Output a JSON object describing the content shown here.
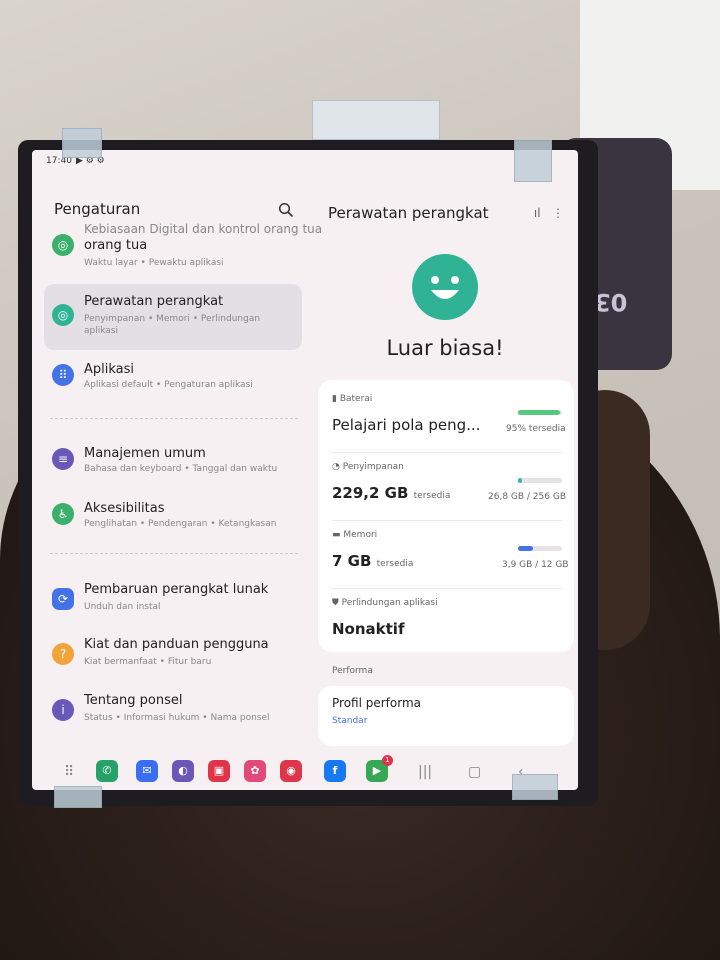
{
  "status_bar": {
    "time": "17:40",
    "icons": "▶ ⚙ ⚙"
  },
  "background": {
    "phone_back_text": "03"
  },
  "settings": {
    "title": "Pengaturan",
    "items": [
      {
        "title": "Kebiasaan Digital dan kontrol orang tua",
        "title_line2": "orang tua",
        "subtitle": "Waktu layar  •  Pewaktu aplikasi",
        "icon": "digital-wellbeing-icon",
        "color": "#3bb06a"
      },
      {
        "title": "Perawatan perangkat",
        "subtitle": "Penyimpanan  •  Memori  •  Perlindungan",
        "subtitle2": "aplikasi",
        "icon": "device-care-icon",
        "color": "#2fb394"
      },
      {
        "title": "Aplikasi",
        "subtitle": "Aplikasi default  •  Pengaturan aplikasi",
        "icon": "apps-icon",
        "color": "#4473e8"
      },
      {
        "title": "Manajemen umum",
        "subtitle": "Bahasa dan keyboard  •  Tanggal dan waktu",
        "icon": "general-management-icon",
        "color": "#6a57b8"
      },
      {
        "title": "Aksesibilitas",
        "subtitle": "Penglihatan  •  Pendengaran  •  Ketangkasan",
        "icon": "accessibility-icon",
        "color": "#3bb06a"
      },
      {
        "title": "Pembaruan perangkat lunak",
        "subtitle": "Unduh dan instal",
        "icon": "software-update-icon",
        "color": "#4473e8"
      },
      {
        "title": "Kiat dan panduan pengguna",
        "subtitle": "Kiat bermanfaat  •  Fitur baru",
        "icon": "tips-icon",
        "color": "#f2a33a"
      },
      {
        "title": "Tentang ponsel",
        "subtitle": "Status  •  Informasi hukum  •  Nama ponsel",
        "icon": "about-phone-icon",
        "color": "#6a57b8"
      }
    ]
  },
  "device_care": {
    "title": "Perawatan perangkat",
    "status": "Luar biasa!",
    "battery": {
      "label": "Baterai",
      "value": "Pelajari pola peng...",
      "level": 0.95,
      "available": "95% tersedia",
      "color": "#57c77d"
    },
    "storage": {
      "label": "Penyimpanan",
      "value": "229,2 GB",
      "suffix": "tersedia",
      "usage": "26,8 GB / 256 GB",
      "fraction": 0.1,
      "color": "#3ab7b0"
    },
    "memory": {
      "label": "Memori",
      "value": "7 GB",
      "suffix": "tersedia",
      "usage": "3,9 GB / 12 GB",
      "fraction": 0.33,
      "color": "#4473e8"
    },
    "app_protection": {
      "label": "Perlindungan aplikasi",
      "value": "Nonaktif"
    },
    "performance": {
      "section": "Performa",
      "profile_label": "Profil performa",
      "profile_value": "Standar"
    }
  },
  "dock": {
    "apps": [
      {
        "name": "phone-app-icon",
        "color": "#26a269",
        "glyph": "✆"
      },
      {
        "name": "messages-app-icon",
        "color": "#3a6df0",
        "glyph": "✉"
      },
      {
        "name": "browser-app-icon",
        "color": "#6a57b8",
        "glyph": "◐"
      },
      {
        "name": "flipboard-app-icon",
        "color": "#e0344a",
        "glyph": "▣"
      },
      {
        "name": "flower-app-icon",
        "color": "#e24a7a",
        "glyph": "✿"
      },
      {
        "name": "camera-app-icon",
        "color": "#e0344a",
        "glyph": "◉"
      },
      {
        "name": "facebook-app-icon",
        "color": "#1877f2",
        "glyph": "f"
      },
      {
        "name": "play-store-app-icon",
        "color": "#34a853",
        "glyph": "▶"
      }
    ],
    "play_badge": "1"
  }
}
